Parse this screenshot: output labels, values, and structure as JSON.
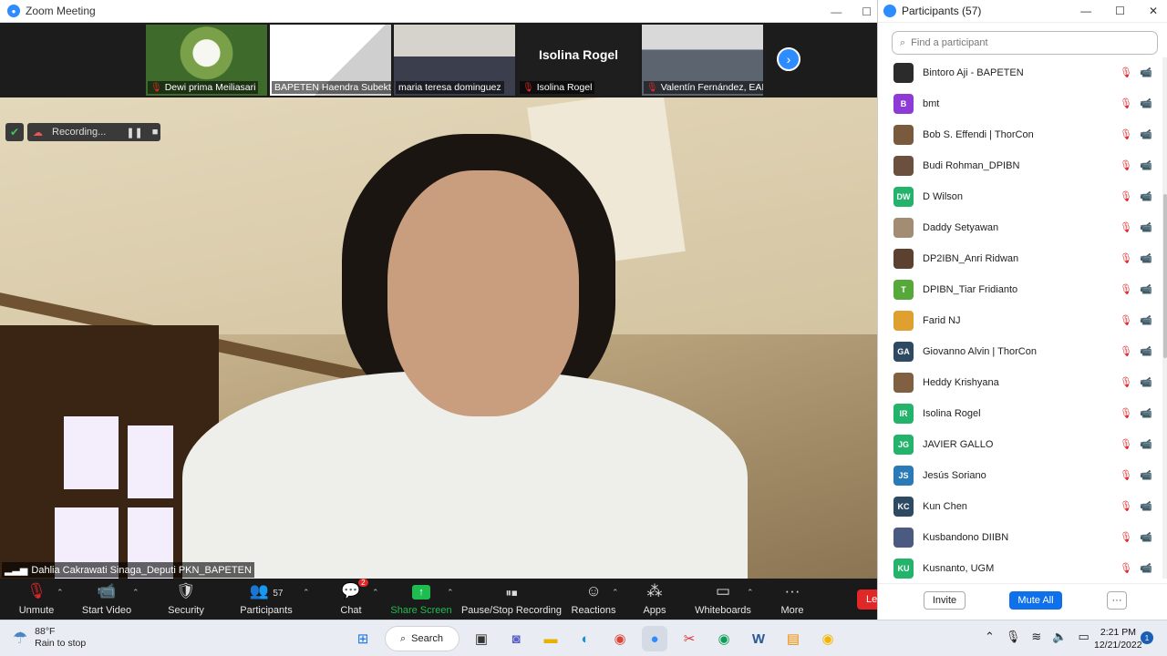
{
  "window": {
    "title": "Zoom Meeting",
    "minimize": "—",
    "maximize": "☐"
  },
  "thumbnails": [
    {
      "name": "Dewi prima Meiliasari",
      "muted": true
    },
    {
      "name": "BAPETEN Haendra Subekti",
      "muted": false
    },
    {
      "name": "maria teresa dominguez",
      "muted": false
    },
    {
      "name": "Isolina Rogel",
      "muted": true,
      "big_label": "Isolina Rogel"
    },
    {
      "name": "Valentín Fernández, EAI",
      "muted": true
    }
  ],
  "recording": {
    "label": "Recording...",
    "pause": "❚❚",
    "stop": "■"
  },
  "active_speaker": "Dahlia Cakrawati Sinaga_Deputi PKN_BAPETEN",
  "toolbar": {
    "unmute": "Unmute",
    "start_video": "Start Video",
    "security": "Security",
    "participants": "Participants",
    "participants_count": "57",
    "chat": "Chat",
    "chat_badge": "2",
    "share_screen": "Share Screen",
    "pause_recording": "Pause/Stop Recording",
    "reactions": "Reactions",
    "apps": "Apps",
    "whiteboards": "Whiteboards",
    "more": "More",
    "leave": "Le"
  },
  "panel": {
    "title": "Participants (57)",
    "search_placeholder": "Find a participant",
    "invite": "Invite",
    "mute_all": "Mute All",
    "more": "···",
    "participants": [
      {
        "name": "Bintoro Aji - BAPETEN",
        "initials": "",
        "color": "#2b2b2b",
        "cam_off": true
      },
      {
        "name": "bmt",
        "initials": "B",
        "color": "#8e3ad6",
        "cam_off": true
      },
      {
        "name": "Bob S. Effendi | ThorCon",
        "initials": "",
        "color": "#7a5a3c",
        "cam_off": false
      },
      {
        "name": "Budi Rohman_DPIBN",
        "initials": "",
        "color": "#6b5040",
        "cam_off": false
      },
      {
        "name": "D Wilson",
        "initials": "DW",
        "color": "#23b36a",
        "cam_off": true
      },
      {
        "name": "Daddy Setyawan",
        "initials": "",
        "color": "#a38c74",
        "cam_off": true
      },
      {
        "name": "DP2IBN_Anri Ridwan",
        "initials": "",
        "color": "#5c4030",
        "cam_off": true
      },
      {
        "name": "DPIBN_Tiar Fridianto",
        "initials": "T",
        "color": "#57a83a",
        "cam_off": true
      },
      {
        "name": "Farid NJ",
        "initials": "",
        "color": "#e0a030",
        "cam_off": true
      },
      {
        "name": "Giovanno Alvin | ThorCon",
        "initials": "GA",
        "color": "#2e4a63",
        "cam_off": true
      },
      {
        "name": "Heddy Krishyana",
        "initials": "",
        "color": "#806040",
        "cam_off": false
      },
      {
        "name": "Isolina Rogel",
        "initials": "IR",
        "color": "#23b36a",
        "cam_off": true
      },
      {
        "name": "JAVIER GALLO",
        "initials": "JG",
        "color": "#23b36a",
        "cam_off": false
      },
      {
        "name": "Jesús Soriano",
        "initials": "JS",
        "color": "#2a7ab8",
        "cam_off": true
      },
      {
        "name": "Kun Chen",
        "initials": "KC",
        "color": "#2e4a63",
        "cam_off": true
      },
      {
        "name": "Kusbandono DIIBN",
        "initials": "",
        "color": "#4a5a80",
        "cam_off": true
      },
      {
        "name": "Kusnanto, UGM",
        "initials": "KU",
        "color": "#23b36a",
        "cam_off": false
      }
    ]
  },
  "taskbar": {
    "temperature": "88°F",
    "weather": "Rain to stop",
    "search": "Search",
    "time": "2:21 PM",
    "date": "12/21/2022",
    "notifications": "1"
  }
}
